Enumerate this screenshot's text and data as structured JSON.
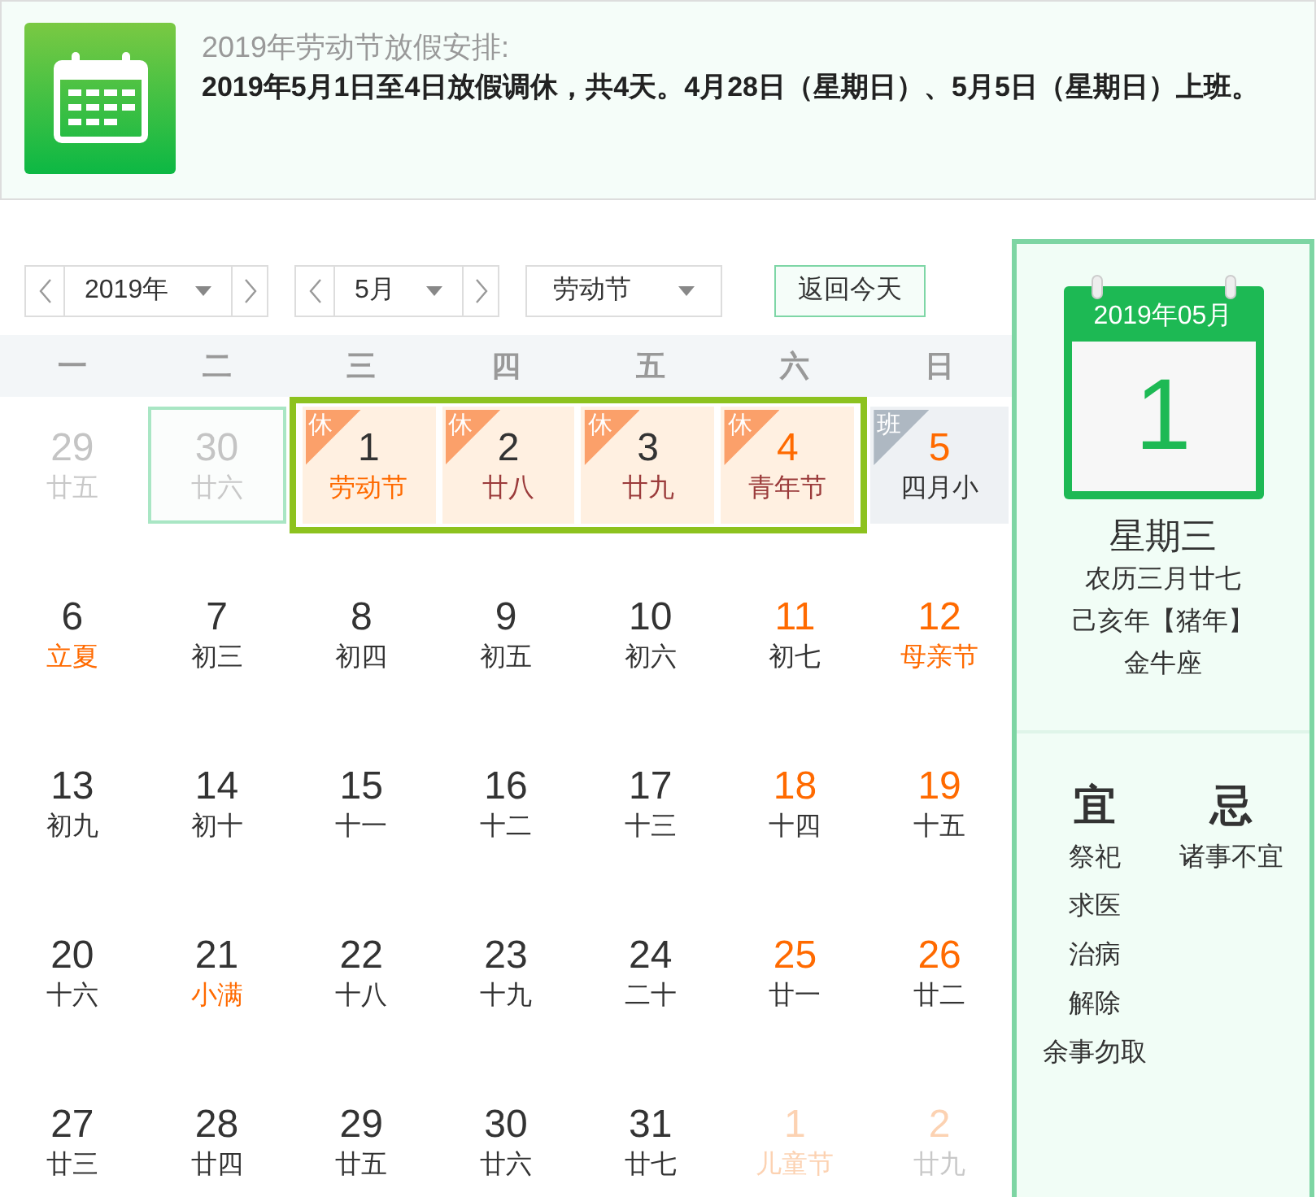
{
  "banner": {
    "title": "2019年劳动节放假安排:",
    "text": "2019年5月1日至4日放假调休，共4天。4月28日（星期日）、5月5日（星期日）上班。"
  },
  "controls": {
    "year": "2019年",
    "month": "5月",
    "holiday": "劳动节",
    "today_button": "返回今天"
  },
  "weekdays": [
    "一",
    "二",
    "三",
    "四",
    "五",
    "六",
    "日"
  ],
  "weeks": [
    [
      {
        "day": "29",
        "lunar": "廿五",
        "kind": "other",
        "weekend": false,
        "festival": false,
        "holiday": false,
        "selected": false
      },
      {
        "day": "30",
        "lunar": "廿六",
        "kind": "other",
        "weekend": false,
        "festival": false,
        "holiday": false,
        "selected": true
      },
      {
        "day": "1",
        "lunar": "劳动节",
        "kind": "current",
        "weekend": false,
        "festival": true,
        "holiday": true,
        "selected": false,
        "badge": {
          "text": "休",
          "kind": "rest"
        }
      },
      {
        "day": "2",
        "lunar": "廿八",
        "kind": "current",
        "weekend": false,
        "festival": false,
        "holiday": true,
        "selected": false,
        "badge": {
          "text": "休",
          "kind": "rest"
        }
      },
      {
        "day": "3",
        "lunar": "廿九",
        "kind": "current",
        "weekend": false,
        "festival": false,
        "holiday": true,
        "selected": false,
        "badge": {
          "text": "休",
          "kind": "rest"
        }
      },
      {
        "day": "4",
        "lunar": "青年节",
        "kind": "current",
        "weekend": true,
        "festival": false,
        "holiday": true,
        "selected": false,
        "badge": {
          "text": "休",
          "kind": "rest"
        }
      },
      {
        "day": "5",
        "lunar": "四月小",
        "kind": "current",
        "weekend": true,
        "festival": false,
        "holiday": false,
        "selected": false,
        "badge": {
          "text": "班",
          "kind": "work"
        }
      }
    ],
    [
      {
        "day": "6",
        "lunar": "立夏",
        "kind": "current",
        "weekend": false,
        "festival": true,
        "holiday": false,
        "selected": false
      },
      {
        "day": "7",
        "lunar": "初三",
        "kind": "current",
        "weekend": false,
        "festival": false,
        "holiday": false,
        "selected": false
      },
      {
        "day": "8",
        "lunar": "初四",
        "kind": "current",
        "weekend": false,
        "festival": false,
        "holiday": false,
        "selected": false
      },
      {
        "day": "9",
        "lunar": "初五",
        "kind": "current",
        "weekend": false,
        "festival": false,
        "holiday": false,
        "selected": false
      },
      {
        "day": "10",
        "lunar": "初六",
        "kind": "current",
        "weekend": false,
        "festival": false,
        "holiday": false,
        "selected": false
      },
      {
        "day": "11",
        "lunar": "初七",
        "kind": "current",
        "weekend": true,
        "festival": false,
        "holiday": false,
        "selected": false
      },
      {
        "day": "12",
        "lunar": "母亲节",
        "kind": "current",
        "weekend": true,
        "festival": true,
        "holiday": false,
        "selected": false
      }
    ],
    [
      {
        "day": "13",
        "lunar": "初九",
        "kind": "current",
        "weekend": false,
        "festival": false,
        "holiday": false,
        "selected": false
      },
      {
        "day": "14",
        "lunar": "初十",
        "kind": "current",
        "weekend": false,
        "festival": false,
        "holiday": false,
        "selected": false
      },
      {
        "day": "15",
        "lunar": "十一",
        "kind": "current",
        "weekend": false,
        "festival": false,
        "holiday": false,
        "selected": false
      },
      {
        "day": "16",
        "lunar": "十二",
        "kind": "current",
        "weekend": false,
        "festival": false,
        "holiday": false,
        "selected": false
      },
      {
        "day": "17",
        "lunar": "十三",
        "kind": "current",
        "weekend": false,
        "festival": false,
        "holiday": false,
        "selected": false
      },
      {
        "day": "18",
        "lunar": "十四",
        "kind": "current",
        "weekend": true,
        "festival": false,
        "holiday": false,
        "selected": false
      },
      {
        "day": "19",
        "lunar": "十五",
        "kind": "current",
        "weekend": true,
        "festival": false,
        "holiday": false,
        "selected": false
      }
    ],
    [
      {
        "day": "20",
        "lunar": "十六",
        "kind": "current",
        "weekend": false,
        "festival": false,
        "holiday": false,
        "selected": false
      },
      {
        "day": "21",
        "lunar": "小满",
        "kind": "current",
        "weekend": false,
        "festival": true,
        "holiday": false,
        "selected": false
      },
      {
        "day": "22",
        "lunar": "十八",
        "kind": "current",
        "weekend": false,
        "festival": false,
        "holiday": false,
        "selected": false
      },
      {
        "day": "23",
        "lunar": "十九",
        "kind": "current",
        "weekend": false,
        "festival": false,
        "holiday": false,
        "selected": false
      },
      {
        "day": "24",
        "lunar": "二十",
        "kind": "current",
        "weekend": false,
        "festival": false,
        "holiday": false,
        "selected": false
      },
      {
        "day": "25",
        "lunar": "廿一",
        "kind": "current",
        "weekend": true,
        "festival": false,
        "holiday": false,
        "selected": false
      },
      {
        "day": "26",
        "lunar": "廿二",
        "kind": "current",
        "weekend": true,
        "festival": false,
        "holiday": false,
        "selected": false
      }
    ],
    [
      {
        "day": "27",
        "lunar": "廿三",
        "kind": "current",
        "weekend": false,
        "festival": false,
        "holiday": false,
        "selected": false
      },
      {
        "day": "28",
        "lunar": "廿四",
        "kind": "current",
        "weekend": false,
        "festival": false,
        "holiday": false,
        "selected": false
      },
      {
        "day": "29",
        "lunar": "廿五",
        "kind": "current",
        "weekend": false,
        "festival": false,
        "holiday": false,
        "selected": false
      },
      {
        "day": "30",
        "lunar": "廿六",
        "kind": "current",
        "weekend": false,
        "festival": false,
        "holiday": false,
        "selected": false
      },
      {
        "day": "31",
        "lunar": "廿七",
        "kind": "current",
        "weekend": false,
        "festival": false,
        "holiday": false,
        "selected": false
      },
      {
        "day": "1",
        "lunar": "儿童节",
        "kind": "other",
        "weekend": true,
        "festival": true,
        "holiday": false,
        "selected": false
      },
      {
        "day": "2",
        "lunar": "廿九",
        "kind": "other",
        "weekend": true,
        "festival": false,
        "holiday": false,
        "selected": false
      }
    ]
  ],
  "detail": {
    "header": "2019年05月",
    "day": "1",
    "weekday": "星期三",
    "lunar": "农历三月廿七",
    "year_name": "己亥年【猪年】",
    "constellation": "金牛座",
    "yi_label": "宜",
    "yi": [
      "祭祀",
      "求医",
      "治病",
      "解除",
      "余事勿取"
    ],
    "ji_label": "忌",
    "ji": [
      "诸事不宜"
    ]
  }
}
